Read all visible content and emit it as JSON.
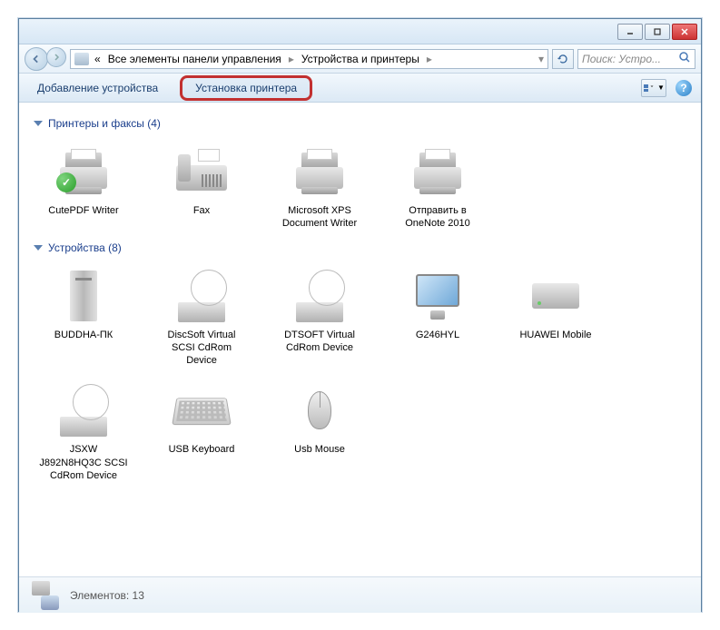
{
  "window": {
    "breadcrumb_prefix": "«",
    "breadcrumb1": "Все элементы панели управления",
    "breadcrumb2": "Устройства и принтеры",
    "search_placeholder": "Поиск: Устро..."
  },
  "toolbar": {
    "add_device": "Добавление устройства",
    "add_printer": "Установка принтера"
  },
  "sections": [
    {
      "title": "Принтеры и факсы (4)",
      "items": [
        {
          "label": "CutePDF Writer",
          "icon": "printer-default"
        },
        {
          "label": "Fax",
          "icon": "fax"
        },
        {
          "label": "Microsoft XPS Document Writer",
          "icon": "printer"
        },
        {
          "label": "Отправить в OneNote 2010",
          "icon": "printer"
        }
      ]
    },
    {
      "title": "Устройства (8)",
      "items": [
        {
          "label": "BUDDHA-ПК",
          "icon": "tower"
        },
        {
          "label": "DiscSoft Virtual SCSI CdRom Device",
          "icon": "disc"
        },
        {
          "label": "DTSOFT Virtual CdRom Device",
          "icon": "disc"
        },
        {
          "label": "G246HYL",
          "icon": "monitor"
        },
        {
          "label": "HUAWEI Mobile",
          "icon": "drive"
        },
        {
          "label": "JSXW J892N8HQ3C SCSI CdRom Device",
          "icon": "disc"
        },
        {
          "label": "USB Keyboard",
          "icon": "keyboard"
        },
        {
          "label": "Usb Mouse",
          "icon": "mouse"
        }
      ]
    }
  ],
  "status": {
    "count_label": "Элементов: 13"
  }
}
